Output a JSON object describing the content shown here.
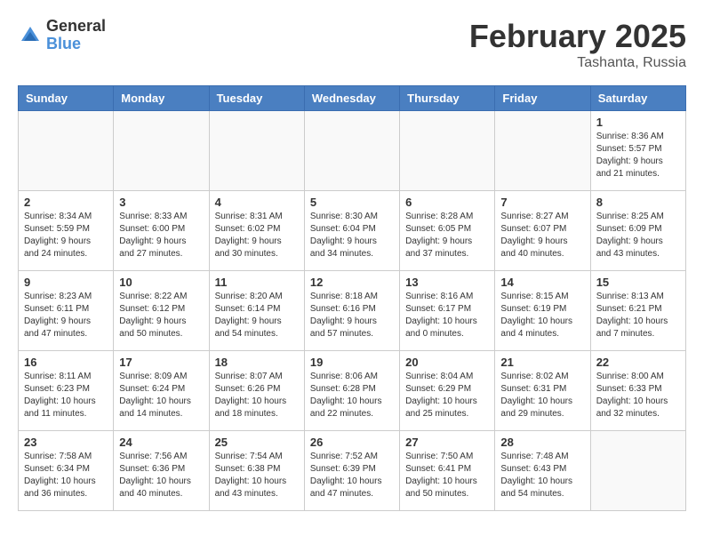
{
  "header": {
    "logo_general": "General",
    "logo_blue": "Blue",
    "month_title": "February 2025",
    "location": "Tashanta, Russia"
  },
  "weekdays": [
    "Sunday",
    "Monday",
    "Tuesday",
    "Wednesday",
    "Thursday",
    "Friday",
    "Saturday"
  ],
  "weeks": [
    [
      {
        "day": "",
        "info": ""
      },
      {
        "day": "",
        "info": ""
      },
      {
        "day": "",
        "info": ""
      },
      {
        "day": "",
        "info": ""
      },
      {
        "day": "",
        "info": ""
      },
      {
        "day": "",
        "info": ""
      },
      {
        "day": "1",
        "info": "Sunrise: 8:36 AM\nSunset: 5:57 PM\nDaylight: 9 hours and 21 minutes."
      }
    ],
    [
      {
        "day": "2",
        "info": "Sunrise: 8:34 AM\nSunset: 5:59 PM\nDaylight: 9 hours and 24 minutes."
      },
      {
        "day": "3",
        "info": "Sunrise: 8:33 AM\nSunset: 6:00 PM\nDaylight: 9 hours and 27 minutes."
      },
      {
        "day": "4",
        "info": "Sunrise: 8:31 AM\nSunset: 6:02 PM\nDaylight: 9 hours and 30 minutes."
      },
      {
        "day": "5",
        "info": "Sunrise: 8:30 AM\nSunset: 6:04 PM\nDaylight: 9 hours and 34 minutes."
      },
      {
        "day": "6",
        "info": "Sunrise: 8:28 AM\nSunset: 6:05 PM\nDaylight: 9 hours and 37 minutes."
      },
      {
        "day": "7",
        "info": "Sunrise: 8:27 AM\nSunset: 6:07 PM\nDaylight: 9 hours and 40 minutes."
      },
      {
        "day": "8",
        "info": "Sunrise: 8:25 AM\nSunset: 6:09 PM\nDaylight: 9 hours and 43 minutes."
      }
    ],
    [
      {
        "day": "9",
        "info": "Sunrise: 8:23 AM\nSunset: 6:11 PM\nDaylight: 9 hours and 47 minutes."
      },
      {
        "day": "10",
        "info": "Sunrise: 8:22 AM\nSunset: 6:12 PM\nDaylight: 9 hours and 50 minutes."
      },
      {
        "day": "11",
        "info": "Sunrise: 8:20 AM\nSunset: 6:14 PM\nDaylight: 9 hours and 54 minutes."
      },
      {
        "day": "12",
        "info": "Sunrise: 8:18 AM\nSunset: 6:16 PM\nDaylight: 9 hours and 57 minutes."
      },
      {
        "day": "13",
        "info": "Sunrise: 8:16 AM\nSunset: 6:17 PM\nDaylight: 10 hours and 0 minutes."
      },
      {
        "day": "14",
        "info": "Sunrise: 8:15 AM\nSunset: 6:19 PM\nDaylight: 10 hours and 4 minutes."
      },
      {
        "day": "15",
        "info": "Sunrise: 8:13 AM\nSunset: 6:21 PM\nDaylight: 10 hours and 7 minutes."
      }
    ],
    [
      {
        "day": "16",
        "info": "Sunrise: 8:11 AM\nSunset: 6:23 PM\nDaylight: 10 hours and 11 minutes."
      },
      {
        "day": "17",
        "info": "Sunrise: 8:09 AM\nSunset: 6:24 PM\nDaylight: 10 hours and 14 minutes."
      },
      {
        "day": "18",
        "info": "Sunrise: 8:07 AM\nSunset: 6:26 PM\nDaylight: 10 hours and 18 minutes."
      },
      {
        "day": "19",
        "info": "Sunrise: 8:06 AM\nSunset: 6:28 PM\nDaylight: 10 hours and 22 minutes."
      },
      {
        "day": "20",
        "info": "Sunrise: 8:04 AM\nSunset: 6:29 PM\nDaylight: 10 hours and 25 minutes."
      },
      {
        "day": "21",
        "info": "Sunrise: 8:02 AM\nSunset: 6:31 PM\nDaylight: 10 hours and 29 minutes."
      },
      {
        "day": "22",
        "info": "Sunrise: 8:00 AM\nSunset: 6:33 PM\nDaylight: 10 hours and 32 minutes."
      }
    ],
    [
      {
        "day": "23",
        "info": "Sunrise: 7:58 AM\nSunset: 6:34 PM\nDaylight: 10 hours and 36 minutes."
      },
      {
        "day": "24",
        "info": "Sunrise: 7:56 AM\nSunset: 6:36 PM\nDaylight: 10 hours and 40 minutes."
      },
      {
        "day": "25",
        "info": "Sunrise: 7:54 AM\nSunset: 6:38 PM\nDaylight: 10 hours and 43 minutes."
      },
      {
        "day": "26",
        "info": "Sunrise: 7:52 AM\nSunset: 6:39 PM\nDaylight: 10 hours and 47 minutes."
      },
      {
        "day": "27",
        "info": "Sunrise: 7:50 AM\nSunset: 6:41 PM\nDaylight: 10 hours and 50 minutes."
      },
      {
        "day": "28",
        "info": "Sunrise: 7:48 AM\nSunset: 6:43 PM\nDaylight: 10 hours and 54 minutes."
      },
      {
        "day": "",
        "info": ""
      }
    ]
  ]
}
